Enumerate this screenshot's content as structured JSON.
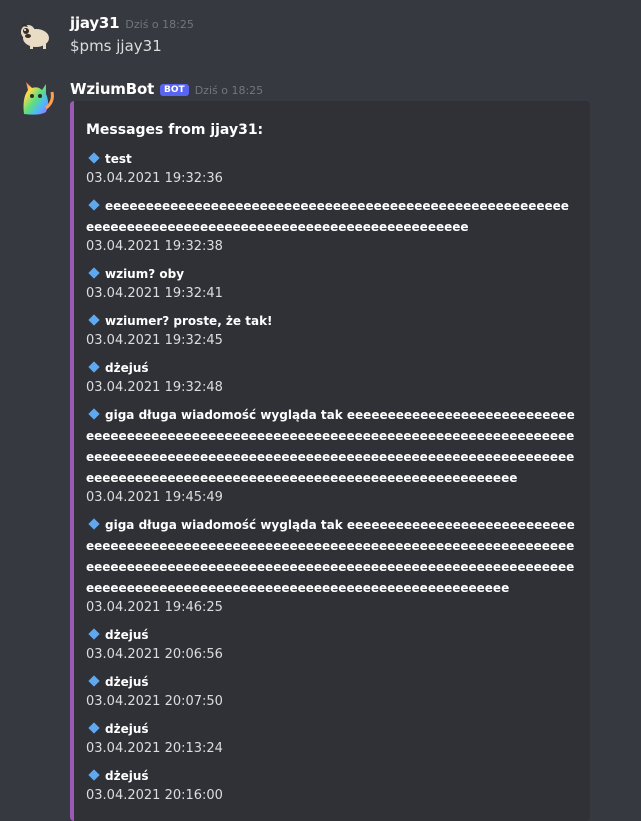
{
  "messages": [
    {
      "author": "jjay31",
      "timestamp": "Dziś o 18:25",
      "content": "$pms jjay31"
    },
    {
      "author": "WziumBot",
      "bot_tag": "BOT",
      "timestamp": "Dziś o 18:25",
      "embed": {
        "accent_color": "#9b59b6",
        "title": "Messages from jjay31:",
        "entries": [
          {
            "text": "test",
            "time": "03.04.2021 19:32:36"
          },
          {
            "text": "eeeeeeeeeeeeeeeeeeeeeeeeeeeeeeeeeeeeeeeeeeeeeeeeeeeeeeeeeeeeeeeeeeeeeeeeeeeeeeeeeeeeeeeeeeeeeeeeeeeeeeee",
            "time": "03.04.2021 19:32:38"
          },
          {
            "text": "wzium? oby",
            "time": "03.04.2021 19:32:41"
          },
          {
            "text": "wziumer? proste, że tak!",
            "time": "03.04.2021 19:32:45"
          },
          {
            "text": "dżejuś",
            "time": "03.04.2021 19:32:48"
          },
          {
            "text": "giga długa wiadomość wygląda tak eeeeeeeeeeeeeeeeeeeeeeeeeeeeeeeeeeeeeeeeeeeeeeeeeeeeeeeeeeeeeeeeeeeeeeeeeeeeeeeeeeeeeeeeeeeeeeeeeeeeeeeeeeeeeeeeeeeeeeeeeeeeeeeeeeeeeeeeeeeeeeeeeeeeeeeeeeeeeeeeeeeeeeeeeeeeeeeeeeeeeeeeeeeeeeeeeeeeeeeee",
            "time": "03.04.2021 19:45:49"
          },
          {
            "text": "giga długa wiadomość wygląda tak eeeeeeeeeeeeeeeeeeeeeeeeeeeeeeeeeeeeeeeeeeeeeeeeeeeeeeeeeeeeeeeeeeeeeeeeeeeeeeeeeeeeeeeeeeeeeeeeeeeeeeeeeeeeeeeeeeeeeeeeeeeeeeeeeeeeeeeeeeeeeeeeeeeeeeeeeeeeeeeeeeeeeeeeeeeeeeeeeeeeeeeeeeeeeeeeeeeeeeee",
            "time": "03.04.2021 19:46:25"
          },
          {
            "text": "dżejuś",
            "time": "03.04.2021 20:06:56"
          },
          {
            "text": "dżejuś",
            "time": "03.04.2021 20:07:50"
          },
          {
            "text": "dżejuś",
            "time": "03.04.2021 20:13:24"
          },
          {
            "text": "dżejuś",
            "time": "03.04.2021 20:16:00"
          }
        ]
      }
    }
  ]
}
